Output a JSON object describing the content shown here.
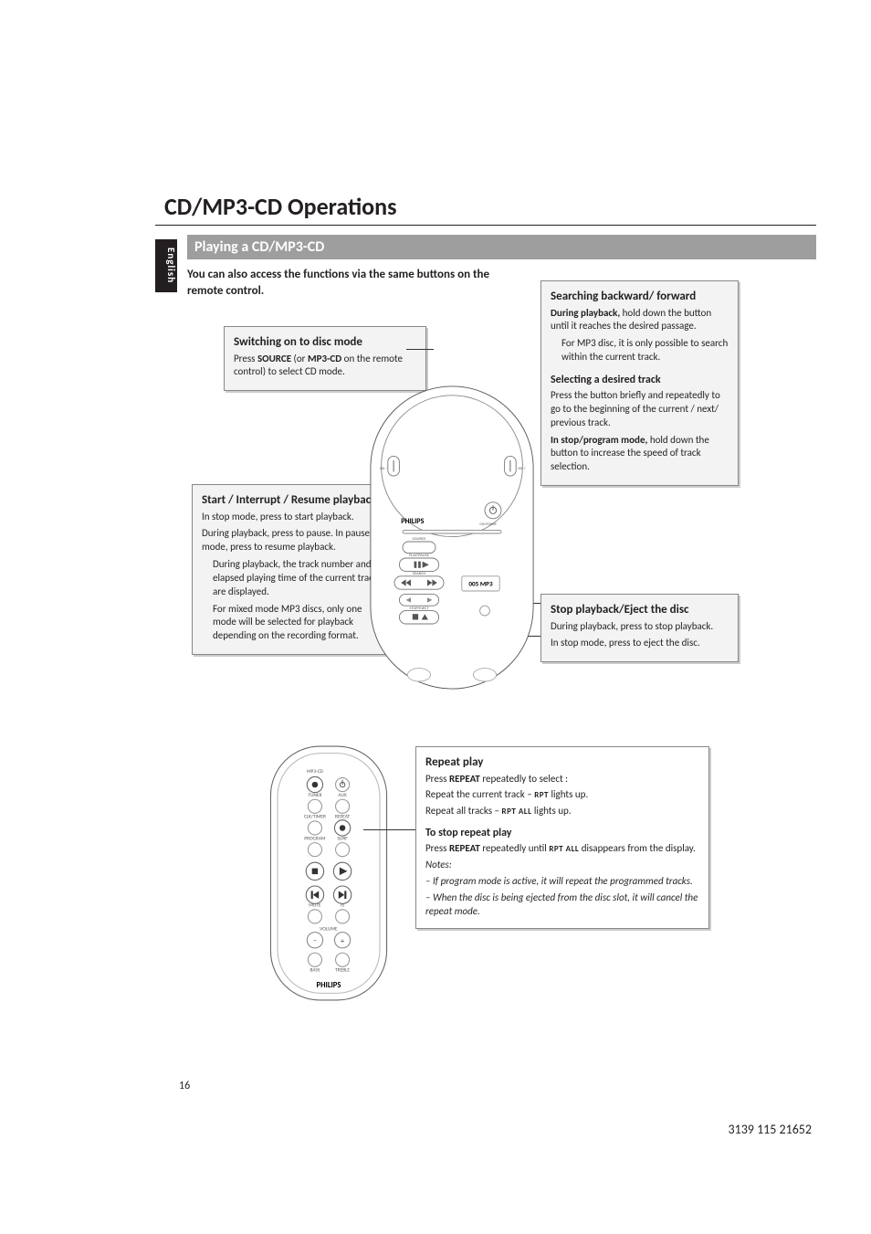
{
  "lang_tab": "English",
  "title": "CD/MP3-CD Operations",
  "subtitle": "Playing a CD/MP3-CD",
  "intro": "You can also access the functions via the same buttons on the remote control.",
  "box_switch": {
    "heading": "Switching on to disc mode",
    "line1_pre": "Press ",
    "line1_b1": "SOURCE",
    "line1_mid": " (or ",
    "line1_b2": "MP3-CD",
    "line1_post": " on the remote control) to select CD mode."
  },
  "box_start": {
    "heading": "Start / Interrupt / Resume playback",
    "p1": "In stop mode, press to start playback.",
    "p2": "During playback, press to pause. In pause mode, press to resume playback.",
    "p3": "During playback, the track number and elapsed playing time of the current track are displayed.",
    "p4": "For mixed mode MP3 discs, only one mode will be selected for playback depending on the recording format."
  },
  "box_search": {
    "h1": "Searching backward/ forward",
    "p1_b": "During playback,",
    "p1": " hold down the button until it reaches the desired passage.",
    "p2": "For MP3 disc, it is only possible to search within the current track.",
    "h2": "Selecting a desired track",
    "p3": "Press the button briefly and repeatedly to go to the beginning of the current / next/ previous track.",
    "p4_b": "In stop/program mode,",
    "p4": " hold down the button to increase the speed of track selection."
  },
  "box_stop": {
    "heading": "Stop playback/Eject the disc",
    "p1": "During playback, press to stop playback.",
    "p2": "In stop mode, press to eject the disc."
  },
  "box_repeat": {
    "h1": "Repeat play",
    "line1_pre": "Press ",
    "line1_b": "REPEAT",
    "line1_post": " repeatedly to select :",
    "bullet1_pre": "Repeat the current track – ",
    "bullet1_sc": "RPT",
    "bullet1_post": " lights up.",
    "bullet2_pre": "Repeat all tracks – ",
    "bullet2_sc": "RPT ALL",
    "bullet2_post": " lights up.",
    "h2": "To stop repeat play",
    "line2_pre": "Press ",
    "line2_b": "REPEAT",
    "line2_mid": " repeatedly until ",
    "line2_sc": "RPT ALL",
    "line2_post": " disappears from the display.",
    "notes_title": "Notes:",
    "note1": "–   If program mode is active, it will repeat the programmed tracks.",
    "note2": "–   When the disc is being ejected from the disc slot, it will cancel the repeat mode."
  },
  "device": {
    "brand": "PHILIPS",
    "vol_minus": "VOL –",
    "vol_plus": "VOL +",
    "dim": "DIM POWER",
    "btn_source": "SOURCE",
    "btn_play": "PLAY/PAUSE",
    "btn_search": "SEARCH",
    "btn_stop": "STOP/EJECT",
    "display": "005 MP3"
  },
  "remote": {
    "brand": "PHILIPS",
    "labels": [
      "MP3-CD",
      "",
      "TUNER",
      "AUX",
      "CLK/TIMER",
      "REPEAT",
      "PROGRAM",
      "SURF",
      "MUTE",
      "IS",
      "VOLUME",
      "BASS",
      "TREBLE"
    ]
  },
  "page_number": "16",
  "footer_code": "3139 115 21652"
}
